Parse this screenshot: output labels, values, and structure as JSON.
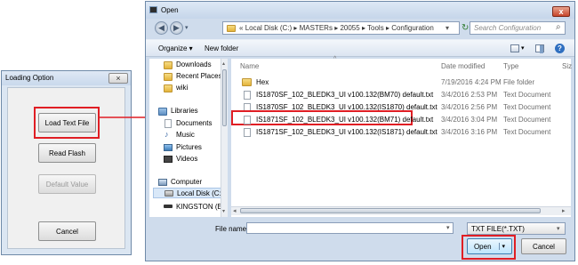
{
  "loading_dialog": {
    "title": "Loading Option",
    "close_glyph": "×",
    "buttons": {
      "load_text_file": "Load Text File",
      "read_flash": "Read Flash",
      "default_value": "Default Value",
      "cancel": "Cancel"
    }
  },
  "open_dialog": {
    "title": "Open",
    "close_glyph": "x",
    "breadcrumb": [
      "Local Disk (C:)",
      "MASTERs",
      "20055",
      "Tools",
      "Configuration"
    ],
    "crumb_prefix": "«",
    "crumb_sep": "▸",
    "search_placeholder": "Search Configuration",
    "toolbar": {
      "organize": "Organize ▾",
      "new_folder": "New folder"
    },
    "nav_items": [
      {
        "label": "Downloads",
        "icon": "downloads-folder-icon"
      },
      {
        "label": "Recent Places",
        "icon": "recent-places-icon"
      },
      {
        "label": "wiki",
        "icon": "folder-icon"
      },
      {
        "label": "Libraries",
        "icon": "libraries-icon"
      },
      {
        "label": "Documents",
        "icon": "documents-icon"
      },
      {
        "label": "Music",
        "icon": "music-icon"
      },
      {
        "label": "Pictures",
        "icon": "pictures-icon"
      },
      {
        "label": "Videos",
        "icon": "videos-icon"
      },
      {
        "label": "Computer",
        "icon": "computer-icon"
      },
      {
        "label": "Local Disk (C:)",
        "icon": "drive-icon"
      },
      {
        "label": "KINGSTON (E:)",
        "icon": "usb-drive-icon"
      }
    ],
    "columns": {
      "name": "Name",
      "date": "Date modified",
      "type": "Type",
      "size": "Siz"
    },
    "files": [
      {
        "name": "Hex",
        "date": "7/19/2016 4:24 PM",
        "type": "File folder",
        "icon": "folder-icon"
      },
      {
        "name": "IS1870SF_102_BLEDK3_UI v100.132(BM70) default.txt",
        "date": "3/4/2016 2:53 PM",
        "type": "Text Document",
        "icon": "text-file-icon"
      },
      {
        "name": "IS1870SF_102_BLEDK3_UI v100.132(IS1870) default.txt",
        "date": "3/4/2016 2:56 PM",
        "type": "Text Document",
        "icon": "text-file-icon"
      },
      {
        "name": "IS1871SF_102_BLEDK3_UI v100.132(BM71) default.txt",
        "date": "3/4/2016 3:04 PM",
        "type": "Text Document",
        "icon": "text-file-icon"
      },
      {
        "name": "IS1871SF_102_BLEDK3_UI v100.132(IS1871) default.txt",
        "date": "3/4/2016 3:16 PM",
        "type": "Text Document",
        "icon": "text-file-icon"
      }
    ],
    "file_name_label": "File name:",
    "file_name_value": "",
    "file_type_value": "TXT FILE(*.TXT)",
    "open_button": "Open",
    "cancel_button": "Cancel"
  },
  "colors": {
    "highlight": "#e01e24",
    "dialog_frame": "#cfdcec",
    "accent_blue": "#1f5fa8"
  }
}
